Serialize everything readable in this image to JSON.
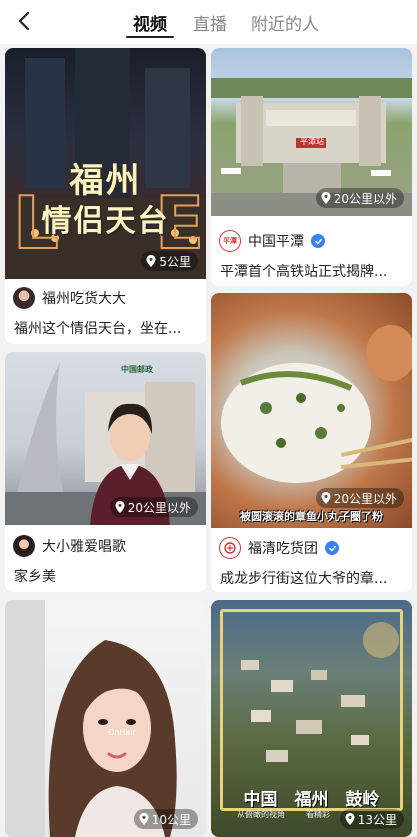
{
  "tabs": [
    {
      "label": "视频",
      "active": true
    },
    {
      "label": "直播",
      "active": false
    },
    {
      "label": "附近的人",
      "active": false
    }
  ],
  "cards": [
    {
      "overlay_line1": "福州",
      "overlay_line2": "情侣天台",
      "distance": "5公里",
      "author": "福州吃货大大",
      "description": "福州这个情侣天台，坐在..."
    },
    {
      "station_sign": "平潭站",
      "distance": "20公里以外",
      "author": "中国平潭",
      "avatar_text": "平潭",
      "verified": true,
      "description": "平潭首个高铁站正式揭牌..."
    },
    {
      "distance": "20公里以外",
      "logo_text": "中国邮政",
      "author": "大小雅爱唱歌",
      "description": "家乡美"
    },
    {
      "caption": "被圆滚滚的章鱼小丸子圈了粉",
      "distance": "20公里以外",
      "author": "福清吃货团",
      "verified": true,
      "description": "成龙步行街这位大爷的章..."
    },
    {
      "watermark": "OnHair",
      "distance": "10公里"
    },
    {
      "title": "中国　福州　鼓岭",
      "subtitle_left": "从俯瞰的视角",
      "subtitle_right": "看精彩",
      "distance": "13公里"
    }
  ],
  "colors": {
    "accent": "#222222",
    "verified": "#3b82f6",
    "background": "#f2f2f2"
  }
}
